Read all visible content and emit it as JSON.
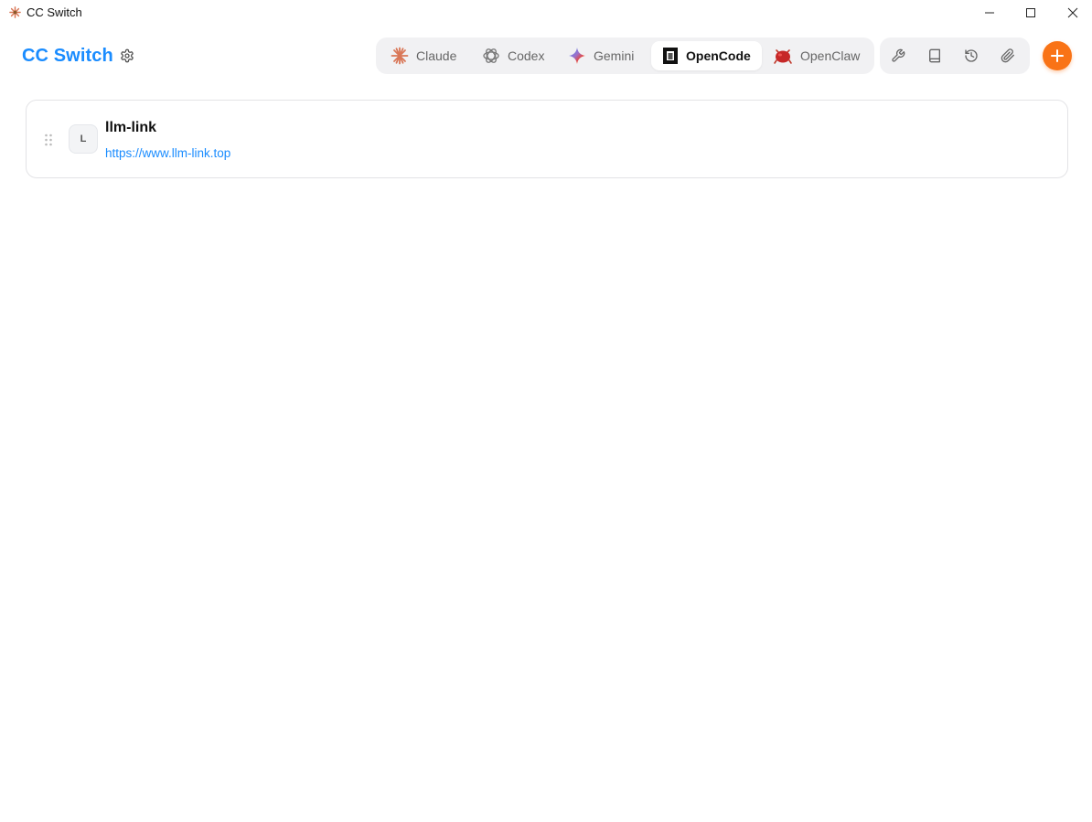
{
  "window": {
    "title": "CC Switch",
    "controls": [
      "minimize-icon",
      "maximize-icon",
      "close-icon"
    ]
  },
  "header": {
    "brand": "CC Switch",
    "settings_icon": "gear-icon"
  },
  "tabs": [
    {
      "label": "Claude",
      "icon": "claude-icon",
      "active": false
    },
    {
      "label": "Codex",
      "icon": "openai-icon",
      "active": false
    },
    {
      "label": "Gemini",
      "icon": "gemini-icon",
      "active": false
    },
    {
      "label": "OpenCode",
      "icon": "opencode-icon",
      "active": true
    },
    {
      "label": "OpenClaw",
      "icon": "openclaw-icon",
      "active": false
    }
  ],
  "tools": [
    "wrench-icon",
    "book-icon",
    "history-icon",
    "paperclip-icon"
  ],
  "add_button_icon": "plus-icon",
  "providers": [
    {
      "initial": "L",
      "name": "llm-link",
      "url": "https://www.llm-link.top"
    }
  ],
  "colors": {
    "brand": "#1a8cff",
    "accent": "#f97316",
    "link": "#1a8cff"
  }
}
